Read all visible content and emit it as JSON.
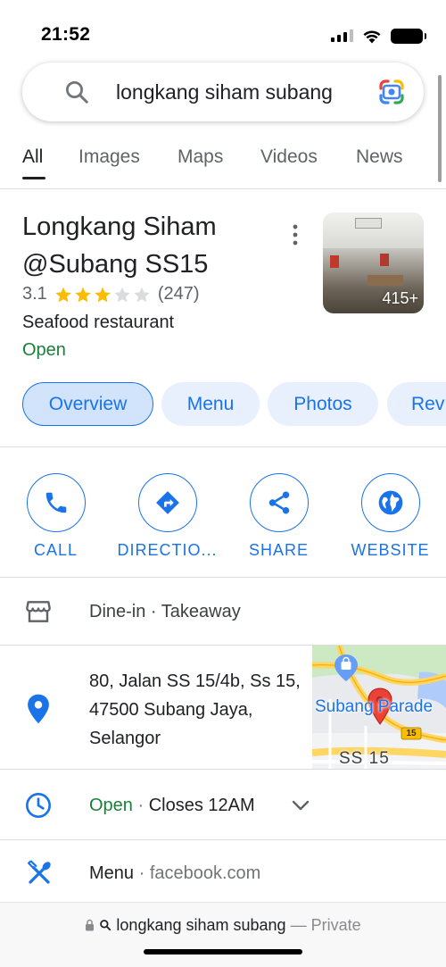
{
  "status_bar": {
    "time": "21:52"
  },
  "search": {
    "query": "longkang siham subang"
  },
  "tabs": [
    {
      "label": "All"
    },
    {
      "label": "Images"
    },
    {
      "label": "Maps"
    },
    {
      "label": "Videos"
    },
    {
      "label": "News"
    }
  ],
  "place": {
    "title_line1": "Longkang Siham",
    "title_line2": "@Subang SS15",
    "rating": "3.1",
    "stars_filled": 3,
    "stars_total": 5,
    "review_count": "(247)",
    "category": "Seafood restaurant",
    "status": "Open",
    "photo_count": "415+"
  },
  "chips": [
    {
      "label": "Overview"
    },
    {
      "label": "Menu"
    },
    {
      "label": "Photos"
    },
    {
      "label": "Rev"
    }
  ],
  "actions": [
    {
      "label": "CALL",
      "icon": "phone-icon"
    },
    {
      "label": "DIRECTIO...",
      "icon": "directions-icon"
    },
    {
      "label": "SHARE",
      "icon": "share-icon"
    },
    {
      "label": "WEBSITE",
      "icon": "globe-icon"
    }
  ],
  "service_options": "Dine-in · Takeaway",
  "address": "80, Jalan SS 15/4b, Ss 15, 47500 Subang Jaya, Selangor",
  "map": {
    "label_parade": "Subang Parade",
    "label_area": "SS 15",
    "route_number": "15"
  },
  "hours": {
    "status": "Open",
    "separator": " · ",
    "closes": "Closes 12AM"
  },
  "menu_row": {
    "label": "Menu",
    "separator": " · ",
    "source": "facebook.com"
  },
  "bottom_bar": {
    "query": "longkang siham subang",
    "suffix": "— Private"
  },
  "colors": {
    "accent": "#1a73e8",
    "open": "#188038",
    "star": "#fbbc04",
    "pin": "#ea4335"
  }
}
